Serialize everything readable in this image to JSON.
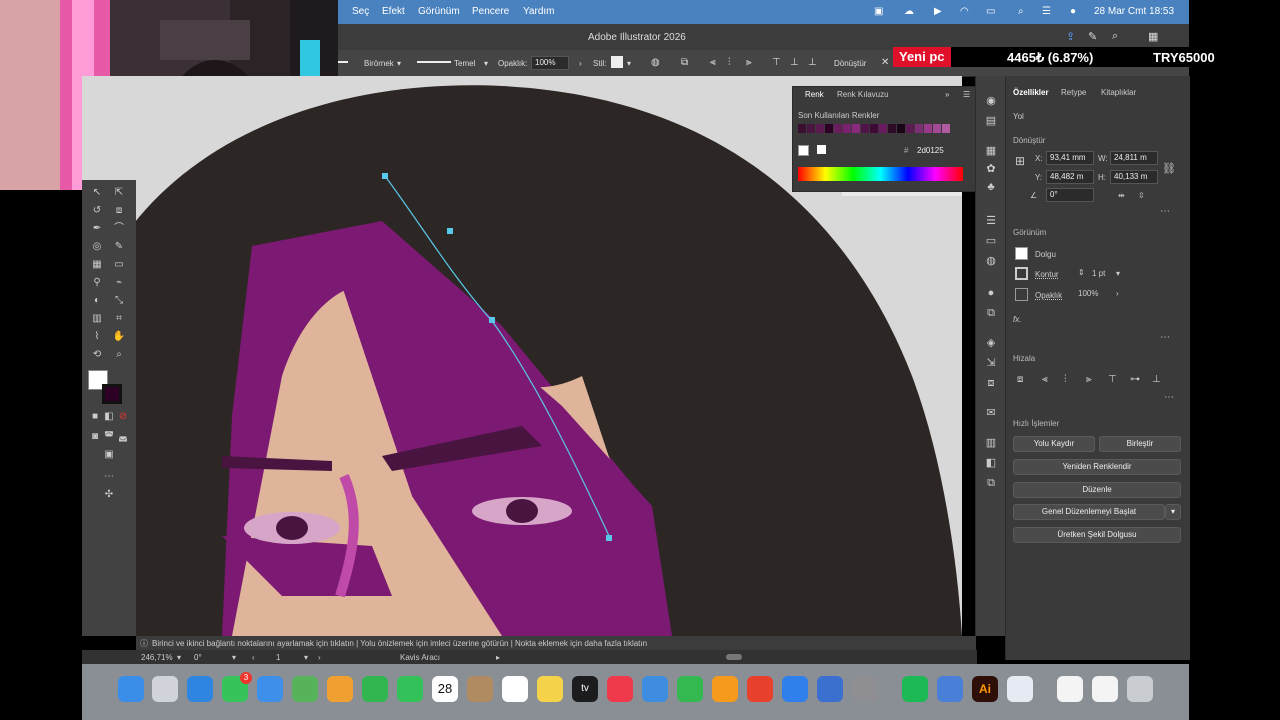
{
  "menubar": {
    "items": [
      "Seç",
      "Efekt",
      "Görünüm",
      "Pencere",
      "Yardım"
    ],
    "clock": "28 Mar Cmt  18:53"
  },
  "titlebar": {
    "title": "Adobe Illustrator 2026"
  },
  "ticker": {
    "label": "Yeni pc",
    "value": "4465₺ (6.87%)",
    "goal": "TRY65000"
  },
  "controlbar": {
    "brush_label": "Birörnek",
    "stroke_style": "Temel",
    "opacity_label": "Opaklık:",
    "opacity_value": "100%",
    "style_label": "Stil:",
    "transform_label": "Dönüştür"
  },
  "color_panel": {
    "tabs": [
      "Renk",
      "Renk Kılavuzu"
    ],
    "recent_label": "Son Kullanılan Renkler",
    "hex_value": "2d0125",
    "swatches": [
      "#3a0f30",
      "#4a1540",
      "#5a1a4f",
      "#2d0125",
      "#6b1e5e",
      "#7a2270",
      "#8a2a7f",
      "#511446",
      "#3e0a35",
      "#6a1a5e",
      "#2d0a26",
      "#1a0518",
      "#5c1c52",
      "#7c3074",
      "#993a8b",
      "#a34a95",
      "#b05aa0"
    ]
  },
  "toolbar": {
    "tools": [
      "selection-tool",
      "direct-selection-tool",
      "pen-tool",
      "curvature-tool",
      "type-tool",
      "line-tool",
      "rectangle-tool",
      "paintbrush-tool",
      "pencil-tool",
      "eraser-tool",
      "rotate-tool",
      "scale-tool",
      "width-tool",
      "free-transform-tool",
      "shape-builder-tool",
      "perspective-tool",
      "mesh-tool",
      "gradient-tool",
      "eyedropper-tool",
      "blend-tool",
      "symbol-sprayer-tool",
      "column-graph-tool",
      "artboard-tool",
      "slice-tool",
      "hand-tool",
      "zoom-tool"
    ]
  },
  "properties": {
    "tabs": [
      "Özellikler",
      "Retype",
      "Kitaplıklar"
    ],
    "object_type": "Yol",
    "transform": {
      "title": "Dönüştür",
      "x_label": "X:",
      "x": "93,41 mm",
      "y_label": "Y:",
      "y": "48,482 m",
      "w_label": "W:",
      "w": "24,811 m",
      "h_label": "H:",
      "h": "40,133 m",
      "angle": "0°"
    },
    "appearance": {
      "title": "Görünüm",
      "fill_label": "Dolgu",
      "stroke_label": "Kontur",
      "stroke_value": "1 pt",
      "opacity_label": "Opaklık",
      "opacity_value": "100%",
      "fx_label": "fx."
    },
    "align": {
      "title": "Hizala"
    },
    "quick_actions": {
      "title": "Hızlı İşlemler",
      "buttons": [
        "Yolu Kaydır",
        "Birleştir",
        "Yeniden Renklendir",
        "Düzenle",
        "Genel Düzenlemeyi Başlat",
        "Üretken Şekil Dolgusu"
      ]
    }
  },
  "status": {
    "hint": "Birinci ve ikinci bağlantı noktalarını ayarlamak için tıklatın  |  Yolu önizlemek için imleci üzerine götürün  |  Nokta eklemek için daha fazla tıklatın",
    "zoom": "246,71%",
    "angle": "0°",
    "artboard": "1",
    "tool": "Kavis Aracı"
  },
  "dock": {
    "calendar_day": "28",
    "apps": [
      {
        "name": "finder",
        "color": "#3b8ee8"
      },
      {
        "name": "launchpad",
        "color": "#d0d4da"
      },
      {
        "name": "safari",
        "color": "#2f86e0"
      },
      {
        "name": "messages",
        "color": "#36c45a"
      },
      {
        "name": "mail",
        "color": "#3d8fea"
      },
      {
        "name": "maps",
        "color": "#57b35a"
      },
      {
        "name": "photos",
        "color": "#f0a030"
      },
      {
        "name": "facetime",
        "color": "#32b650"
      },
      {
        "name": "phone",
        "color": "#33c159"
      },
      {
        "name": "calendar",
        "color": "#ffffff"
      },
      {
        "name": "contacts",
        "color": "#b08a60"
      },
      {
        "name": "reminders",
        "color": "#ffffff"
      },
      {
        "name": "notes",
        "color": "#f4d24a"
      },
      {
        "name": "tv",
        "color": "#1c1c1e"
      },
      {
        "name": "music",
        "color": "#f03a4c"
      },
      {
        "name": "keynote",
        "color": "#3e8de0"
      },
      {
        "name": "numbers",
        "color": "#34b850"
      },
      {
        "name": "pages",
        "color": "#f59a1a"
      },
      {
        "name": "rocketsim",
        "color": "#e8402c"
      },
      {
        "name": "app-store",
        "color": "#2f80ed"
      },
      {
        "name": "preview",
        "color": "#3b6fd0"
      },
      {
        "name": "system-settings",
        "color": "#8e8e93"
      },
      {
        "name": "spotify",
        "color": "#1db954"
      },
      {
        "name": "finder-2",
        "color": "#4a7fd8"
      },
      {
        "name": "illustrator",
        "color": "#2d0f08"
      },
      {
        "name": "vpn",
        "color": "#e6eaf2"
      },
      {
        "name": "document",
        "color": "#f4f4f4"
      },
      {
        "name": "display",
        "color": "#f4f4f4"
      },
      {
        "name": "trash",
        "color": "#c9ccd0"
      }
    ],
    "badge": "3"
  },
  "icons": {
    "ai_label": "Ai",
    "tv_label": "tv"
  }
}
